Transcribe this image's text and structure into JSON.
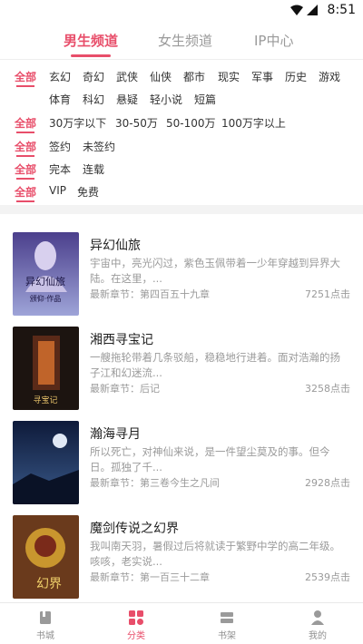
{
  "status_bar": {
    "time": "8:51"
  },
  "top_tabs": [
    {
      "label": "男生频道",
      "active": true
    },
    {
      "label": "女生频道",
      "active": false
    },
    {
      "label": "IP中心",
      "active": false
    }
  ],
  "filters": {
    "all_label": "全部",
    "genres_row1": [
      "玄幻",
      "奇幻",
      "武侠",
      "仙侠",
      "都市",
      "现实",
      "军事",
      "历史",
      "游戏"
    ],
    "genres_row2": [
      "体育",
      "科幻",
      "悬疑",
      "轻小说",
      "短篇"
    ],
    "word_counts": [
      "30万字以下",
      "30-50万",
      "50-100万",
      "100万字以上"
    ],
    "sign_status": [
      "签约",
      "未签约"
    ],
    "completion": [
      "完本",
      "连载"
    ],
    "pricing": [
      "VIP",
      "免费"
    ]
  },
  "books": [
    {
      "title": "异幻仙旅",
      "desc": "宇宙中，亮光闪过，紫色玉佩带着一少年穿越到异界大陆。在这里，...",
      "latest": "最新章节：第四百五十九章",
      "clicks": "7251点击",
      "cover_text": "异幻仙旅",
      "cover_sub": "颁仰·作品"
    },
    {
      "title": "湘西寻宝记",
      "desc": "一艘拖轮带着几条驳船，稳稳地行进着。面对浩瀚的扬子江和幻迷流...",
      "latest": "最新章节：后记",
      "clicks": "3258点击",
      "cover_text": "寻宝记"
    },
    {
      "title": "瀚海寻月",
      "desc": "所以死亡，对神仙来说，是一件望尘莫及的事。但今日。孤独了千...",
      "latest": "最新章节：第三卷今生之凡间",
      "clicks": "2928点击"
    },
    {
      "title": "魔剑传说之幻界",
      "desc": "我叫南天羽，暑假过后将就读于繁野中学的高二年级。咳咳，老实说...",
      "latest": "最新章节：第一百三十二章",
      "clicks": "2539点击",
      "cover_text": "幻界"
    }
  ],
  "bottom_nav": [
    {
      "label": "书城",
      "icon": "bookstore-icon",
      "active": false
    },
    {
      "label": "分类",
      "icon": "category-icon",
      "active": true
    },
    {
      "label": "书架",
      "icon": "bookshelf-icon",
      "active": false
    },
    {
      "label": "我的",
      "icon": "profile-icon",
      "active": false
    }
  ],
  "colors": {
    "accent": "#e84e6a",
    "muted": "#9a9a9a"
  }
}
